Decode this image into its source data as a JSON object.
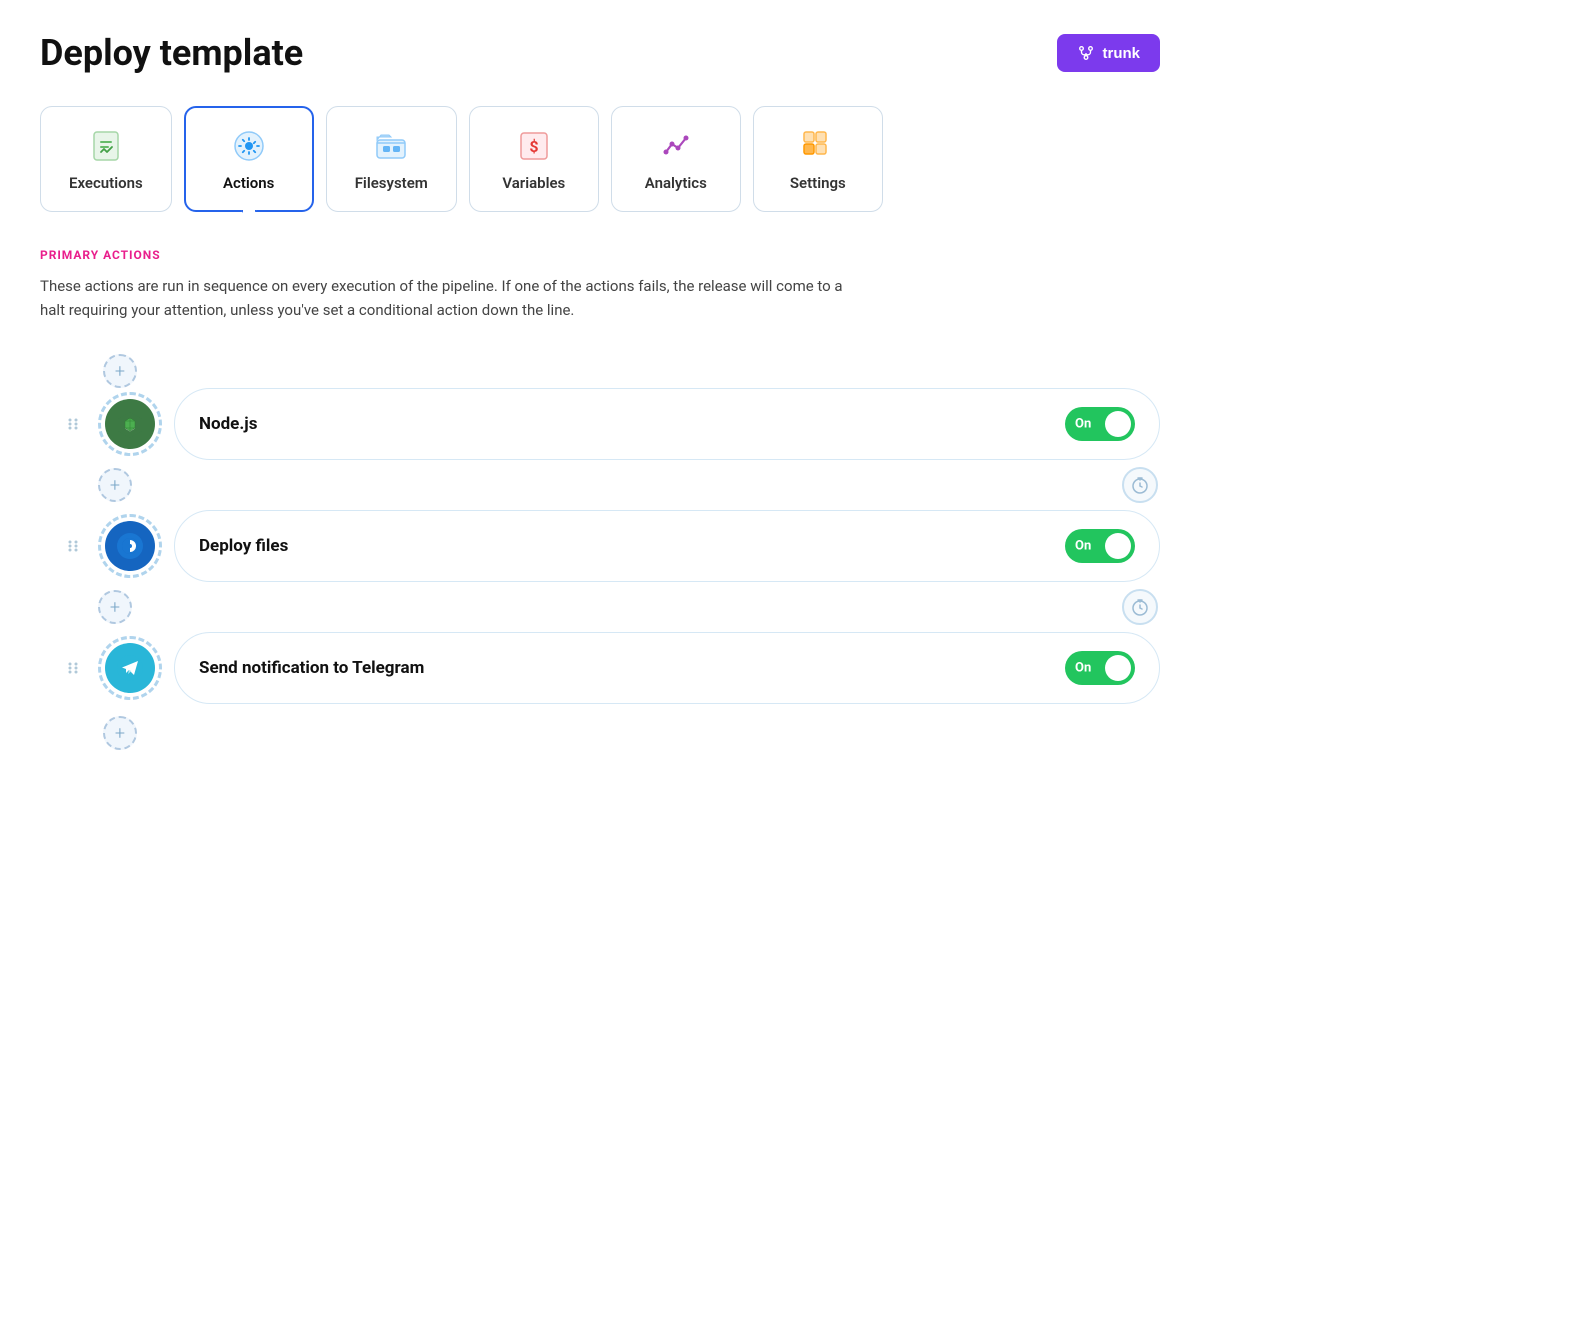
{
  "page": {
    "title": "Deploy template",
    "trunk_label": "trunk"
  },
  "tabs": [
    {
      "id": "executions",
      "label": "Executions",
      "active": false,
      "icon": "executions"
    },
    {
      "id": "actions",
      "label": "Actions",
      "active": true,
      "icon": "actions"
    },
    {
      "id": "filesystem",
      "label": "Filesystem",
      "active": false,
      "icon": "filesystem"
    },
    {
      "id": "variables",
      "label": "Variables",
      "active": false,
      "icon": "variables"
    },
    {
      "id": "analytics",
      "label": "Analytics",
      "active": false,
      "icon": "analytics"
    },
    {
      "id": "settings",
      "label": "Settings",
      "active": false,
      "icon": "settings"
    }
  ],
  "primary_actions": {
    "section_label": "PRIMARY ACTIONS",
    "description": "These actions are run in sequence on every execution of the pipeline. If one of the actions fails, the release will come to a halt requiring your attention, unless you've set a conditional action down the line.",
    "actions": [
      {
        "id": "nodejs",
        "name": "Node.js",
        "toggle": "On",
        "icon": "nodejs"
      },
      {
        "id": "deploy-files",
        "name": "Deploy files",
        "toggle": "On",
        "icon": "deploy"
      },
      {
        "id": "telegram",
        "name": "Send notification to Telegram",
        "toggle": "On",
        "icon": "telegram"
      }
    ]
  },
  "icons": {
    "toggle_on": "On"
  }
}
